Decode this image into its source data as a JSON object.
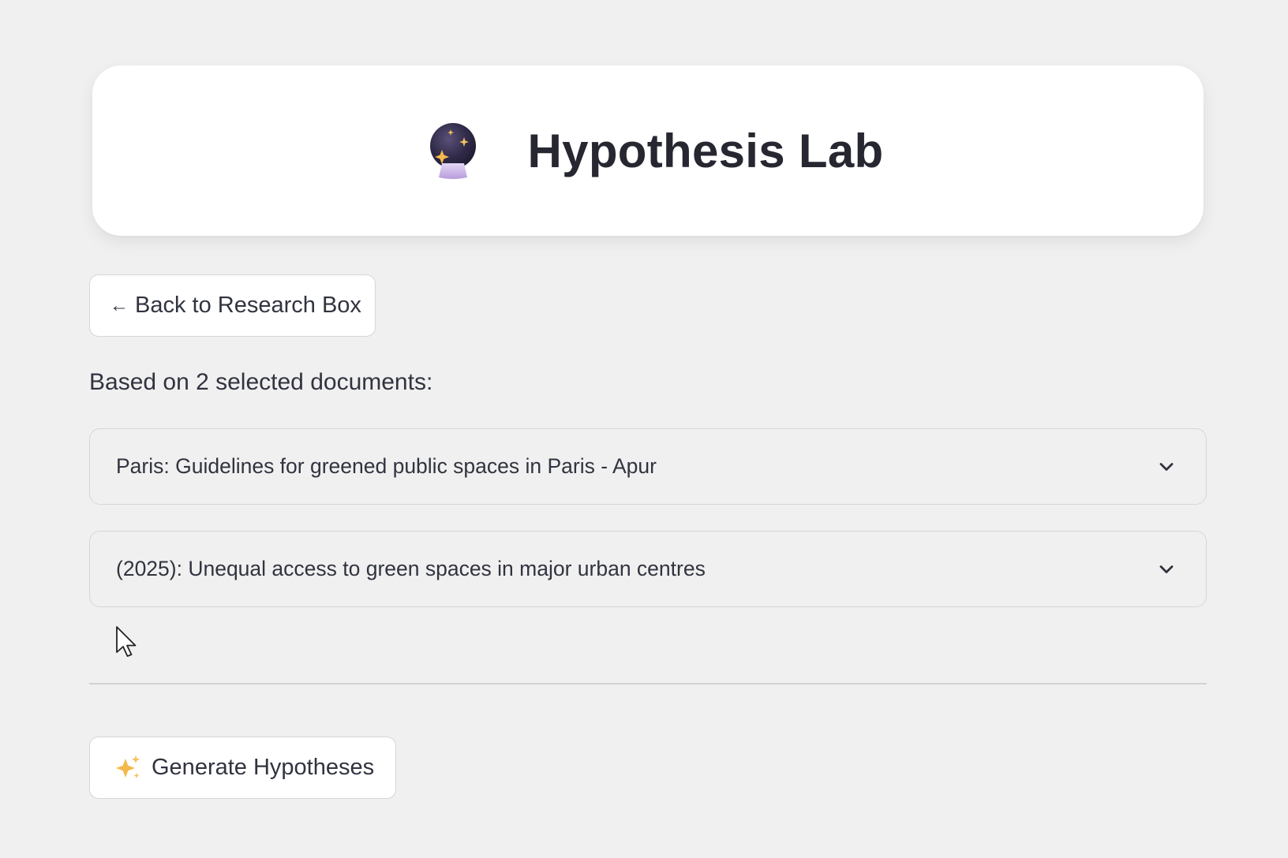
{
  "header": {
    "icon": "crystal-ball-icon",
    "title": "Hypothesis Lab"
  },
  "back_button": {
    "icon": "arrow-left-icon",
    "arrow": "←",
    "label": "Back to Research Box"
  },
  "selection_summary": "Based on 2 selected documents:",
  "documents": [
    {
      "title": "Paris: Guidelines for greened public spaces in Paris - Apur",
      "expanded": false
    },
    {
      "title": "(2025): Unequal access to green spaces in major urban centres",
      "expanded": false
    }
  ],
  "generate_button": {
    "icon": "sparkles-icon",
    "label": "Generate Hypotheses"
  },
  "colors": {
    "background": "#f0f0f0",
    "card": "#ffffff",
    "text": "#31333f",
    "border": "#d6d6d9",
    "accent_gold": "#f4b94a",
    "crystal_ball": "#2f2a4a"
  }
}
